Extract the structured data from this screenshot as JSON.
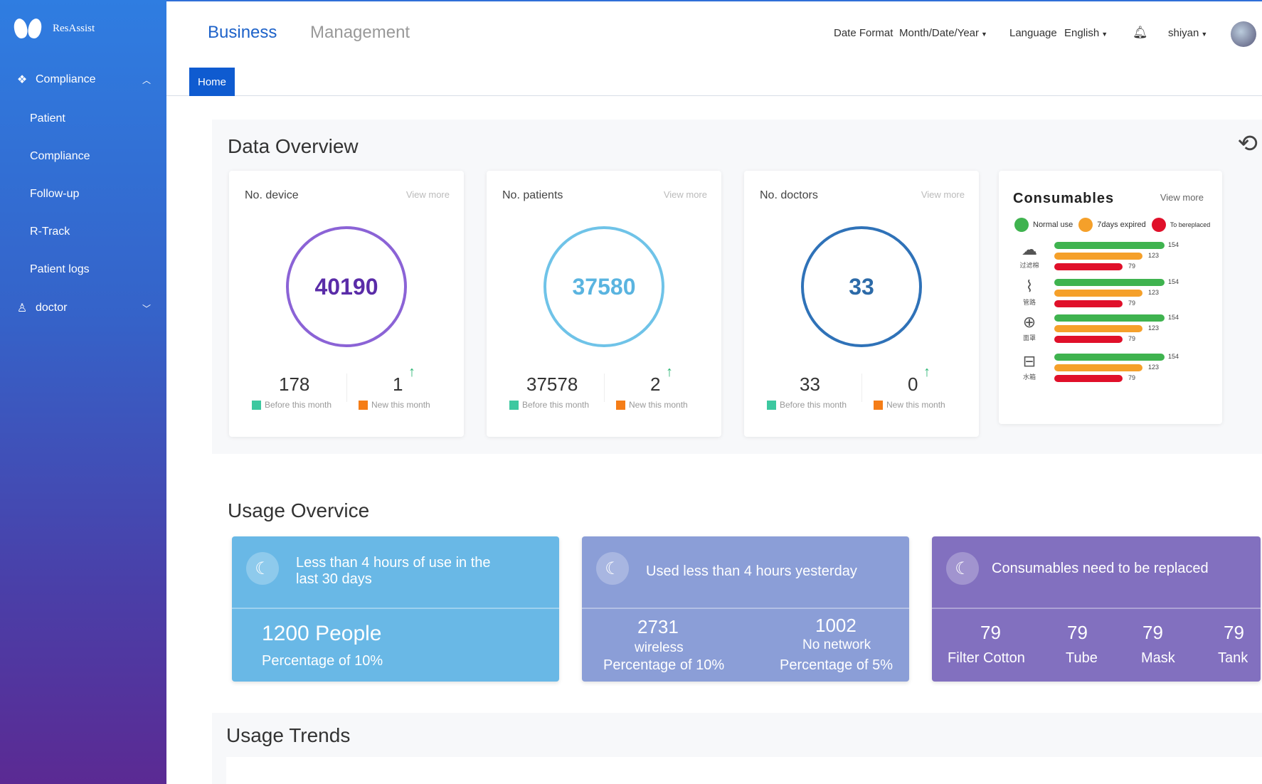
{
  "app": {
    "logo_text": "ResAssist"
  },
  "sidebar": {
    "group_compliance": "Compliance",
    "items": [
      "Patient",
      "Compliance",
      "Follow-up",
      "R-Track",
      "Patient logs"
    ],
    "group_doctor": "doctor"
  },
  "topbar": {
    "tab_business": "Business",
    "tab_management": "Management",
    "date_format_label": "Date Format",
    "date_format_value": "Month/Date/Year",
    "language_label": "Language",
    "language_value": "English",
    "user": "shiyan"
  },
  "home_tab": "Home",
  "data_overview": {
    "title": "Data Overview",
    "cards": [
      {
        "label": "No. device",
        "more": "View more",
        "total": "40190",
        "before": "178",
        "new": "1",
        "ring_color": "#8b63d6",
        "num_color": "#5a2ca8"
      },
      {
        "label": "No. patients",
        "more": "View more",
        "total": "37580",
        "before": "37578",
        "new": "2",
        "ring_color": "#6fc3e8",
        "num_color": "#5ab4e0"
      },
      {
        "label": "No. doctors",
        "more": "View more",
        "total": "33",
        "before": "33",
        "new": "0",
        "ring_color": "#2f72b8",
        "num_color": "#2c6aa8"
      }
    ],
    "legend_before": "Before this month",
    "legend_new": "New this month",
    "consumables": {
      "title": "Consumables",
      "more": "View more",
      "legend": [
        "Normal use",
        "7days expired",
        "To bereplaced"
      ],
      "items": [
        {
          "caption": "过滤棉",
          "values": [
            "154",
            "123",
            "79"
          ]
        },
        {
          "caption": "管路",
          "values": [
            "154",
            "123",
            "79"
          ]
        },
        {
          "caption": "面罩",
          "values": [
            "154",
            "123",
            "79"
          ]
        },
        {
          "caption": "水箱",
          "values": [
            "154",
            "123",
            "79"
          ]
        }
      ]
    }
  },
  "usage_overview": {
    "title": "Usage Overvice",
    "card1": {
      "head": "Less than 4 hours of use in the last 30 days",
      "value": "1200 People",
      "pct": "Percentage of 10%"
    },
    "card2": {
      "head": "Used less than 4 hours yesterday",
      "a_value": "2731",
      "a_label": "wireless",
      "a_pct": "Percentage of 10%",
      "b_value": "1002",
      "b_label": "No network",
      "b_pct": "Percentage of 5%"
    },
    "card3": {
      "head": "Consumables need to be replaced",
      "items": [
        {
          "value": "79",
          "label": "Filter Cotton"
        },
        {
          "value": "79",
          "label": "Tube"
        },
        {
          "value": "79",
          "label": "Mask"
        },
        {
          "value": "79",
          "label": "Tank"
        }
      ]
    }
  },
  "usage_trends": {
    "title": "Usage Trends"
  },
  "colors": {
    "accent": "#1d62c9",
    "green": "#3fb34f",
    "orange": "#f5a02a",
    "red": "#e0102a",
    "teal_legend": "#3cc8a0",
    "orange_legend": "#f57d17"
  }
}
